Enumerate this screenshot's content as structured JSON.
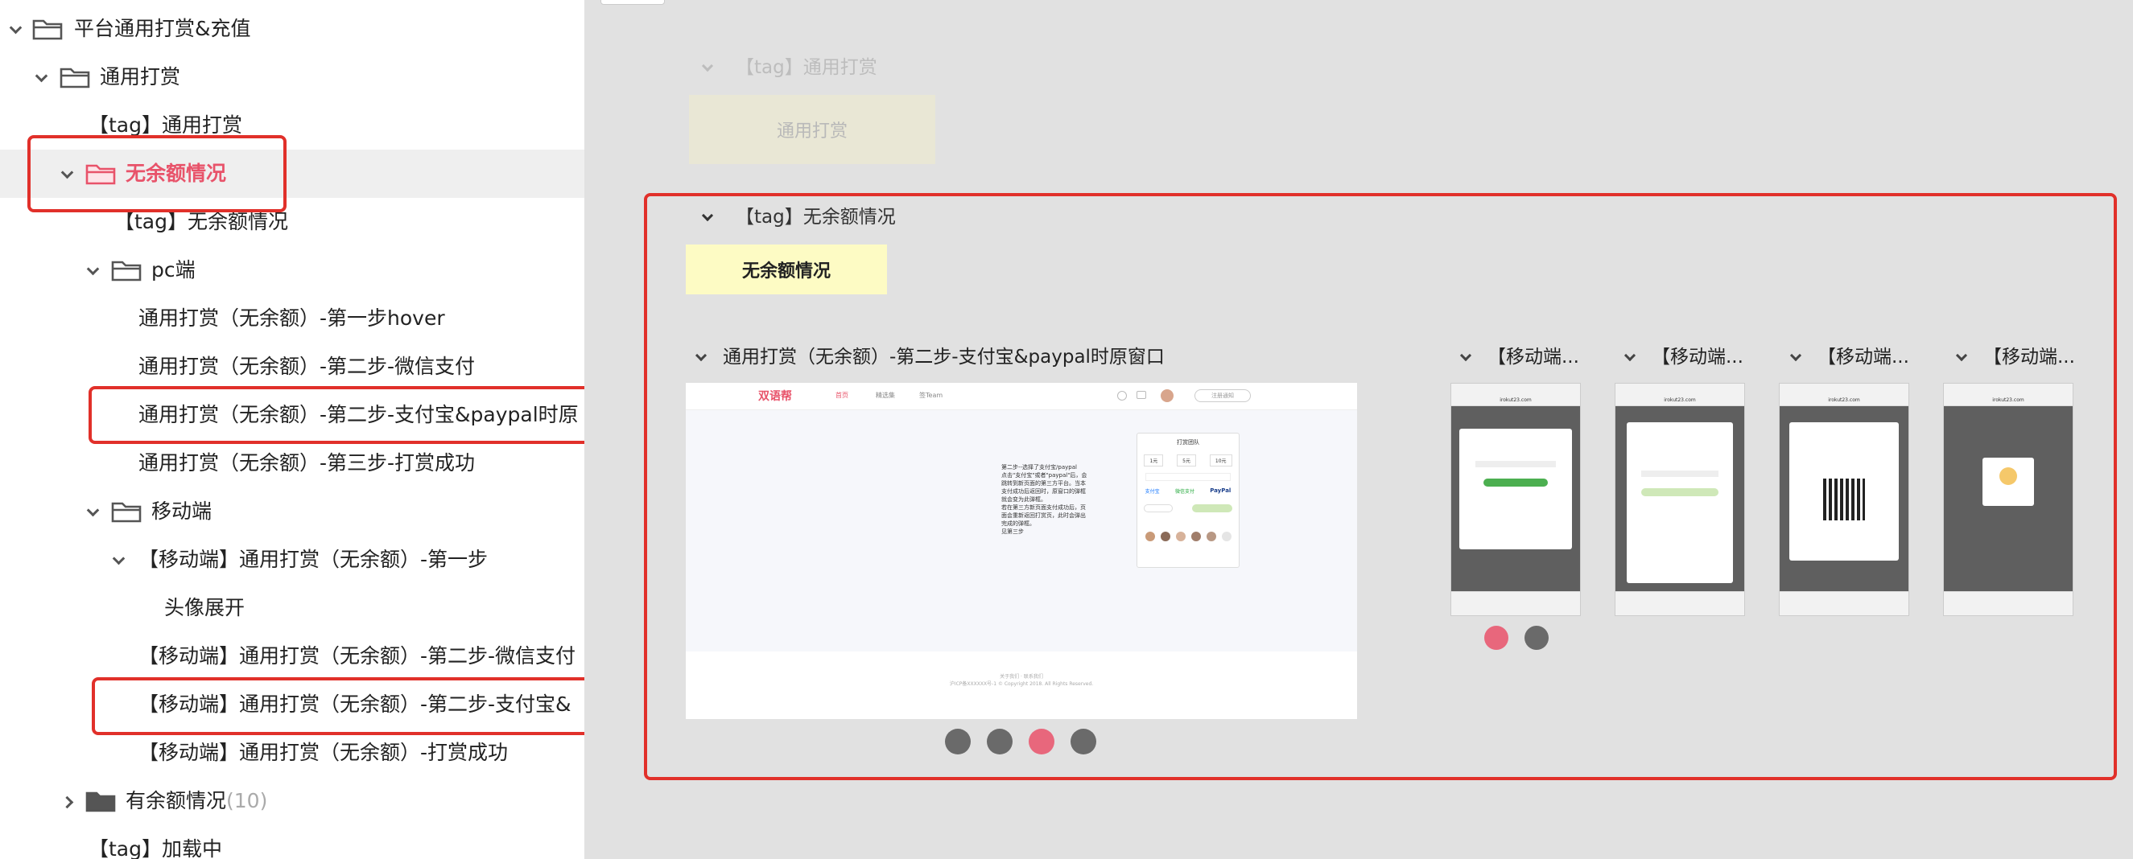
{
  "tree": {
    "items": [
      {
        "label": "平台通用打赏&充值",
        "count": ""
      },
      {
        "label": "通用打赏",
        "count": ""
      },
      {
        "label": "【tag】通用打赏",
        "count": ""
      },
      {
        "label": "无余额情况",
        "count": ""
      },
      {
        "label": "【tag】无余额情况",
        "count": ""
      },
      {
        "label": "pc端",
        "count": ""
      },
      {
        "label": "通用打赏（无余额）-第一步hover",
        "count": ""
      },
      {
        "label": "通用打赏（无余额）-第二步-微信支付",
        "count": ""
      },
      {
        "label": "通用打赏（无余额）-第二步-支付宝&paypal时原",
        "count": ""
      },
      {
        "label": "通用打赏（无余额）-第三步-打赏成功",
        "count": ""
      },
      {
        "label": "移动端",
        "count": ""
      },
      {
        "label": "【移动端】通用打赏（无余额）-第一步",
        "count": ""
      },
      {
        "label": "头像展开",
        "count": ""
      },
      {
        "label": "【移动端】通用打赏（无余额）-第二步-微信支付",
        "count": ""
      },
      {
        "label": "【移动端】通用打赏（无余额）-第二步-支付宝&",
        "count": ""
      },
      {
        "label": "【移动端】通用打赏（无余额）-打赏成功",
        "count": ""
      },
      {
        "label": "有余额情况",
        "count": "(10)"
      },
      {
        "label": "【tag】加载中",
        "count": ""
      }
    ]
  },
  "canvas": {
    "section1": {
      "title": "【tag】通用打赏",
      "box": "通用打赏"
    },
    "section2": {
      "title": "【tag】无余额情况",
      "box": "无余额情况"
    },
    "pc_frame": {
      "title": "通用打赏（无余额）-第二步-支付宝&paypal时原窗口",
      "logo": "双语帮",
      "nav": [
        "首页",
        "精选集",
        "签Team"
      ],
      "search": "注册通知",
      "note": "第二步--选择了支付宝/paypal\n点击\"支付宝\"或者\"paypal\"后，会跳转到新页面的第三方平台。当本支付成功后返回时，原窗口的弹框就会变为此弹框。\n若在第三方新页面支付成功后，页面会重新返回打赏页，此时会弹出完成的弹框。\n见第三步",
      "popup_title": "打赏团队",
      "popup_amounts": [
        "1元",
        "5元",
        "10元"
      ],
      "popup_pay": [
        "支付宝",
        "微信支付",
        "PayPal"
      ],
      "footer1": "关于我们 · 联系我们",
      "footer2": "沪ICP备XXXXXX号-1 © Copyright 2018. All Rights Reserved.",
      "dots": 4,
      "active_dot": 3
    },
    "mobile_frames": [
      {
        "title": "【移动端...",
        "url": "irokut23.com"
      },
      {
        "title": "【移动端...",
        "url": "irokut23.com"
      },
      {
        "title": "【移动端...",
        "url": "irokut23.com"
      },
      {
        "title": "【移动端...",
        "url": "irokut23.com"
      }
    ],
    "mobile_dots": 2,
    "mobile_active_dot": 1
  },
  "colors": {
    "accent": "#e8536a",
    "highlight_red": "#e1302a",
    "tag_yellow": "#fdfbc4",
    "canvas_bg": "#e1e1e1"
  }
}
